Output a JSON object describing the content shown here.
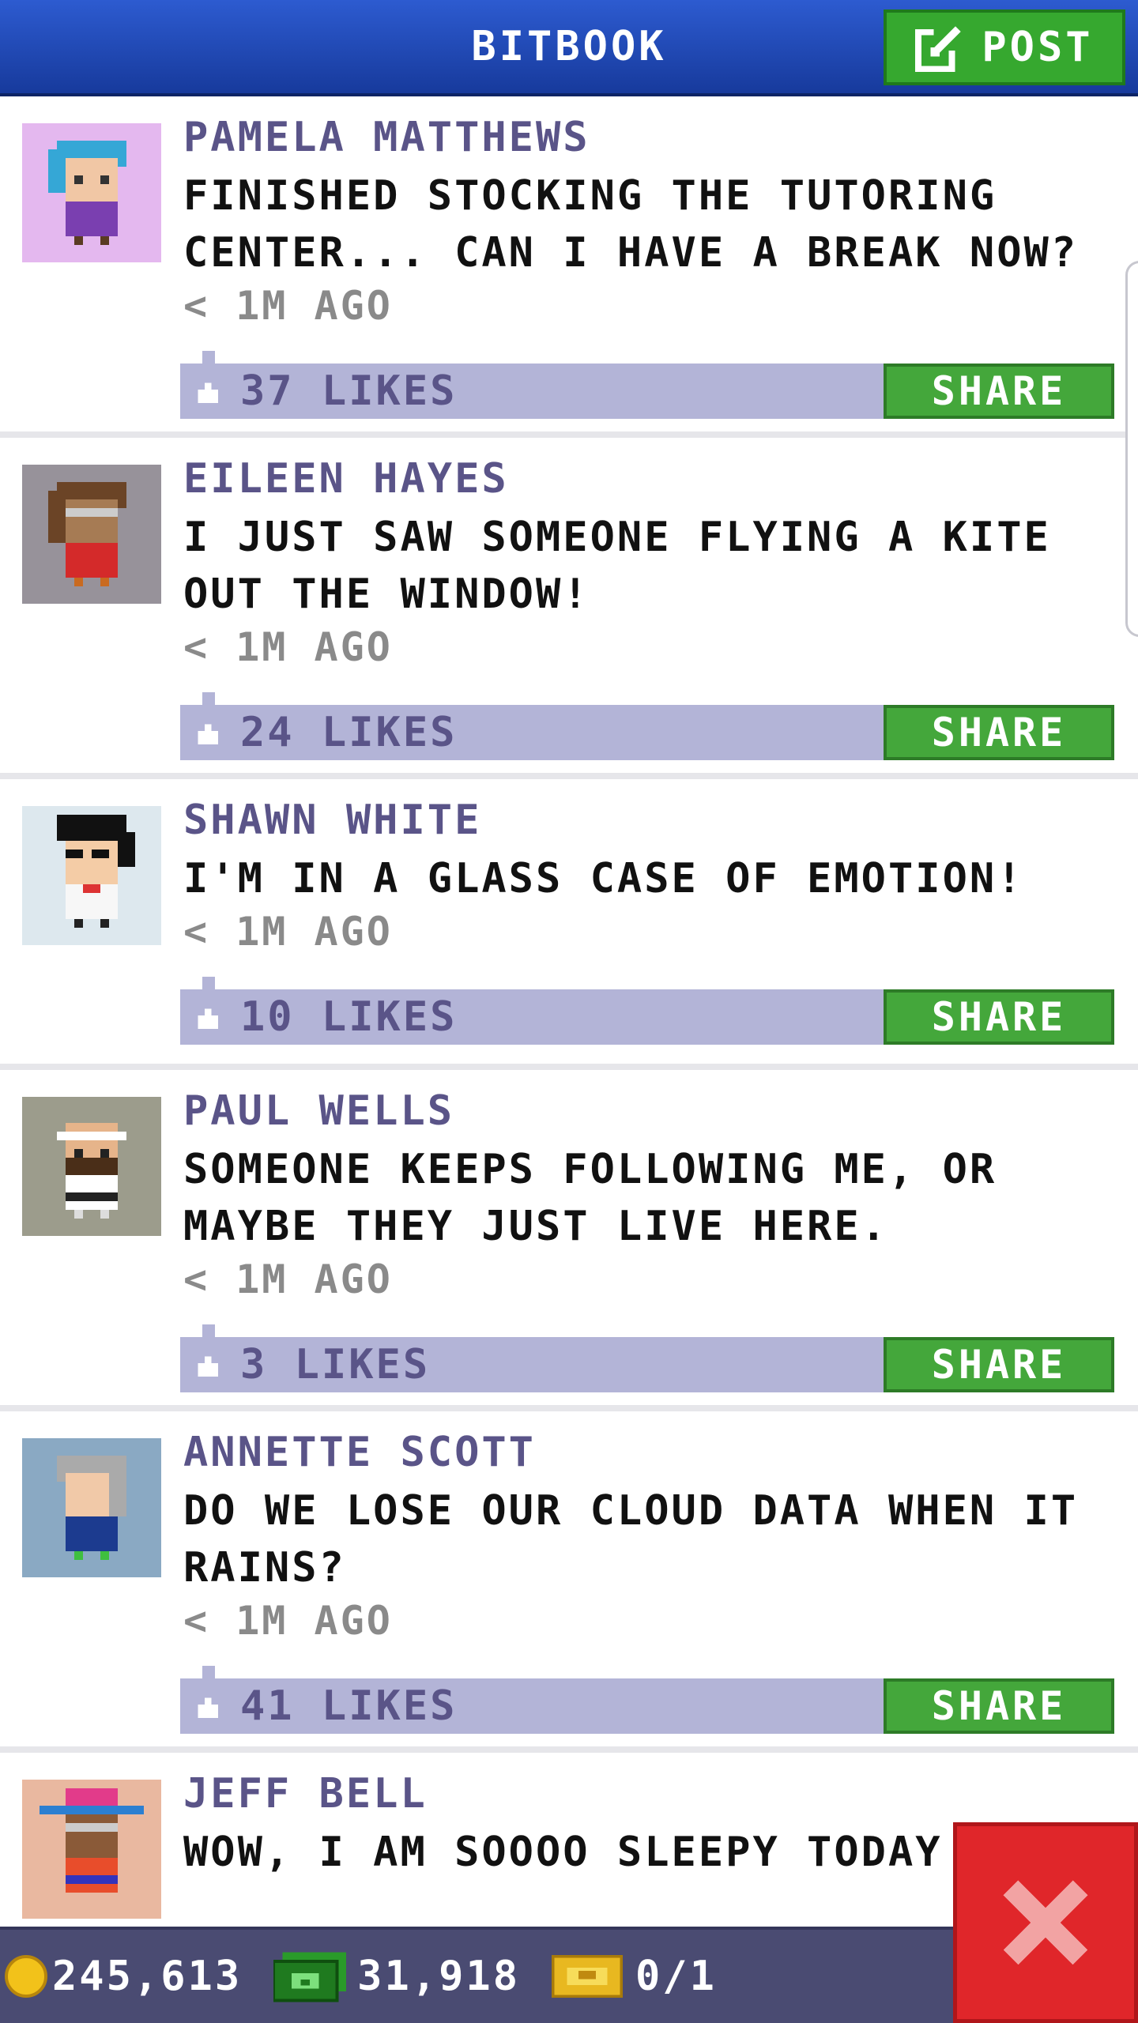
{
  "header": {
    "title": "BITBOOK",
    "post_label": "POST"
  },
  "posts": [
    {
      "name": "PAMELA MATTHEWS",
      "message": "FINISHED STOCKING THE TUTORING CENTER... CAN I HAVE A BREAK NOW?",
      "time": "< 1M AGO",
      "likes": "37 LIKES",
      "share": "SHARE"
    },
    {
      "name": "EILEEN HAYES",
      "message": "I JUST SAW SOMEONE FLYING A KITE OUT THE WINDOW!",
      "time": "< 1M AGO",
      "likes": "24 LIKES",
      "share": "SHARE"
    },
    {
      "name": "SHAWN WHITE",
      "message": "I'M IN A GLASS CASE OF EMOTION!",
      "time": "< 1M AGO",
      "likes": "10 LIKES",
      "share": "SHARE"
    },
    {
      "name": "PAUL WELLS",
      "message": "SOMEONE KEEPS FOLLOWING ME, OR MAYBE THEY JUST LIVE HERE.",
      "time": "< 1M AGO",
      "likes": "3 LIKES",
      "share": "SHARE"
    },
    {
      "name": "ANNETTE SCOTT",
      "message": "DO WE LOSE OUR CLOUD DATA WHEN IT RAINS?",
      "time": "< 1M AGO",
      "likes": "41 LIKES",
      "share": "SHARE"
    },
    {
      "name": "JEFF BELL",
      "message": "WOW, I AM SOOOO SLEEPY TODAY"
    }
  ],
  "status": {
    "coins": "245,613",
    "bux": "31,918",
    "tickets": "0/1"
  },
  "icons": {
    "post": "compose-icon",
    "like": "thumbs-up-icon",
    "coin": "coin-icon",
    "cash": "cash-icon",
    "ticket": "golden-ticket-icon",
    "close": "close-icon"
  },
  "colors": {
    "header": "#2d5bd0",
    "green": "#36a82f",
    "likes_bar": "#b3b4d7",
    "name": "#5a5488",
    "close": "#e0262a",
    "status_bar": "#4a4b72"
  }
}
